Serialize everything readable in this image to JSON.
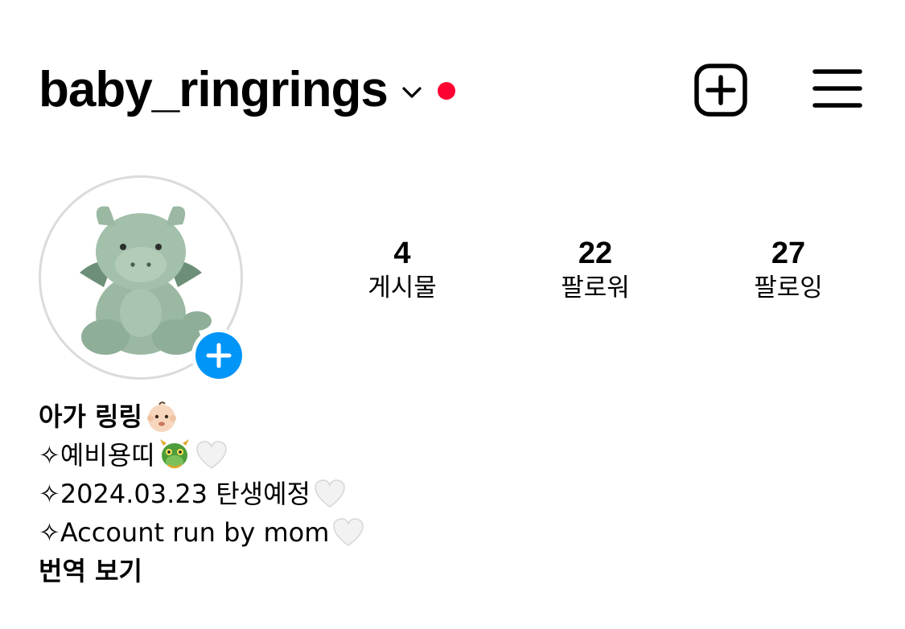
{
  "header": {
    "username": "baby_ringrings",
    "chevron_icon": "chevron-down-icon",
    "notification_dot_color": "#ff0033",
    "add_icon": "plus-square-icon",
    "menu_icon": "hamburger-menu-icon"
  },
  "profile": {
    "avatar_icon": "plush-dragon-avatar",
    "story_add_icon": "plus-icon",
    "story_add_color": "#0095f6"
  },
  "stats": [
    {
      "value": "4",
      "label": "게시물"
    },
    {
      "value": "22",
      "label": "팔로워"
    },
    {
      "value": "27",
      "label": "팔로잉"
    }
  ],
  "bio": {
    "name": "아가 링링",
    "name_emoji": "baby-face-emoji",
    "lines": [
      {
        "text": "✧예비용띠",
        "emojis": [
          "dragon-face-emoji",
          "white-heart-emoji"
        ]
      },
      {
        "text": "✧2024.03.23 탄생예정",
        "emojis": [
          "white-heart-emoji"
        ]
      },
      {
        "text": "✧Account run by mom",
        "emojis": [
          "white-heart-emoji"
        ]
      }
    ],
    "translate_label": "번역 보기"
  }
}
